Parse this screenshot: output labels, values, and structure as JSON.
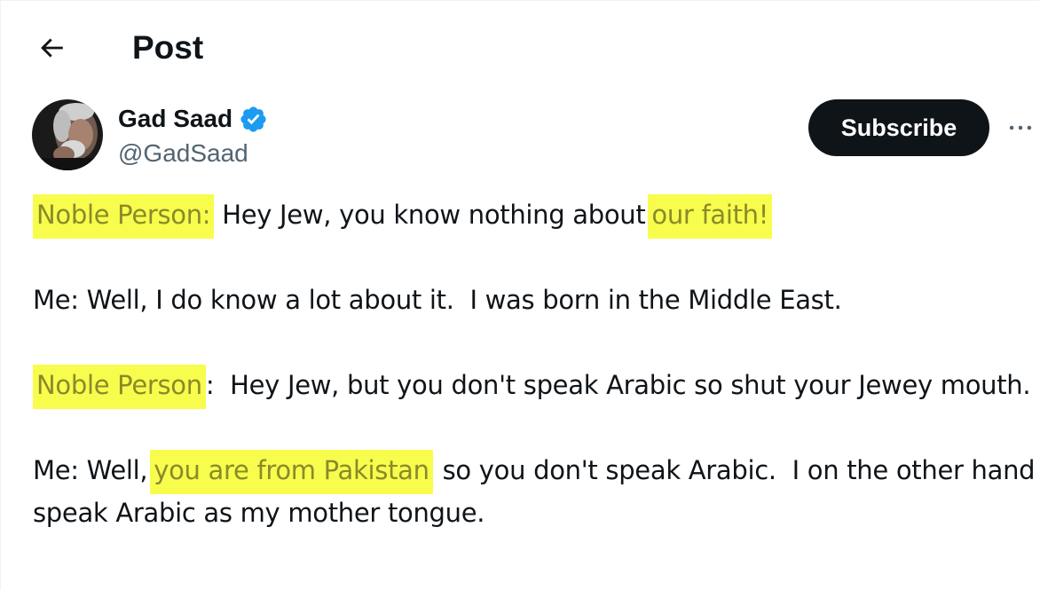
{
  "header": {
    "back_icon": "arrow-left-icon",
    "title": "Post"
  },
  "author": {
    "display_name": "Gad Saad",
    "handle": "@GadSaad",
    "verified_icon": "verified-badge-icon",
    "verified_color": "#1d9bf0",
    "subscribe_label": "Subscribe",
    "more_icon": "more-horizontal-icon"
  },
  "tweet": {
    "p1": {
      "hl1": "Noble Person:",
      "t1": " Hey Jew, you know nothing about ",
      "hl2": "our faith!"
    },
    "p2": {
      "t1": "Me: Well, I do know a lot about it.  I was born in the Middle East."
    },
    "p3": {
      "hl1": "Noble Person",
      "t1": ":  Hey Jew, but you don't speak Arabic so shut your Jewey mouth."
    },
    "p4": {
      "t1": "Me: Well, ",
      "hl1": "you are from Pakistan",
      "t2": " so you don't speak Arabic.  I on the other hand speak Arabic as my mother tongue."
    }
  },
  "colors": {
    "highlight": "#f8fc4c",
    "text": "#0f1419",
    "secondary": "#536471"
  }
}
